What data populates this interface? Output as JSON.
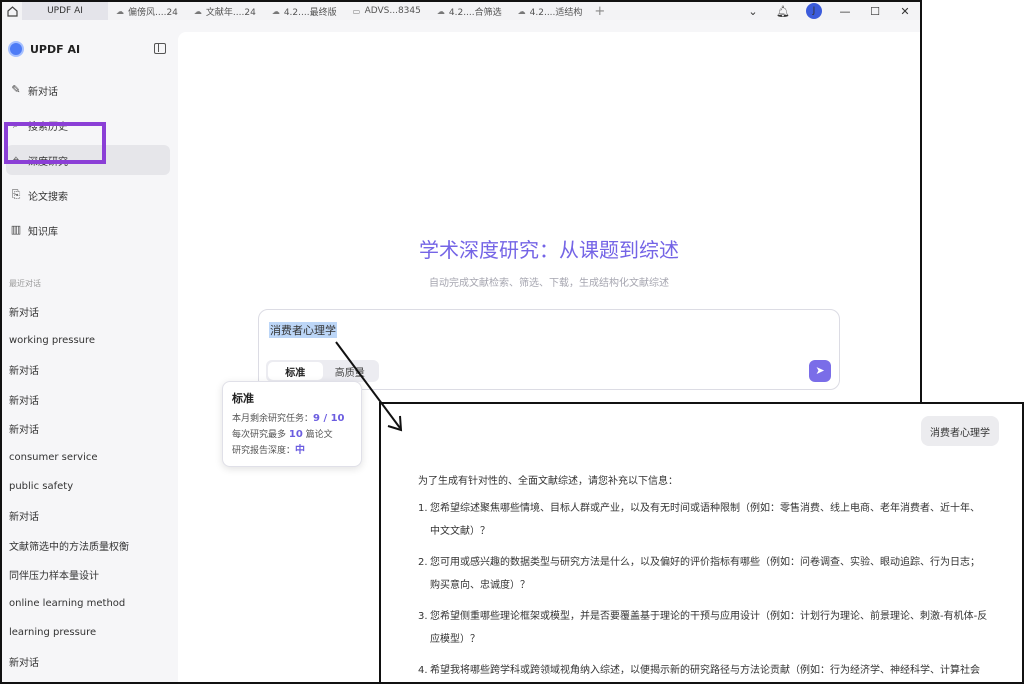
{
  "tabs": [
    {
      "label": "UPDF AI",
      "icon": "",
      "active": true
    },
    {
      "label": "偏傍风....24",
      "icon": "cloud-icon"
    },
    {
      "label": "文献年....24",
      "icon": "cloud-icon"
    },
    {
      "label": "4.2....最终版",
      "icon": "cloud-icon"
    },
    {
      "label": "ADVS...8345",
      "icon": "monitor-icon"
    },
    {
      "label": "4.2....合筛选",
      "icon": "cloud-icon"
    },
    {
      "label": "4.2....适结构",
      "icon": "cloud-icon"
    }
  ],
  "user_initial": "J",
  "brand": "UPDF AI",
  "nav": [
    {
      "label": "新对话",
      "icon": "edit-icon"
    },
    {
      "label": "搜索历史",
      "icon": "search-icon"
    },
    {
      "label": "深度研究",
      "icon": "telescope-icon"
    },
    {
      "label": "论文搜索",
      "icon": "paper-search-icon"
    },
    {
      "label": "知识库",
      "icon": "books-icon"
    }
  ],
  "recent_title": "最近对话",
  "recent": [
    "新对话",
    "working pressure",
    "新对话",
    "新对话",
    "新对话",
    "consumer service",
    "public safety",
    "新对话",
    "文献筛选中的方法质量权衡",
    "同伴压力样本量设计",
    "online learning method",
    "learning pressure",
    "新对话"
  ],
  "main": {
    "title": "学术深度研究：从课题到综述",
    "subtitle": "自动完成文献检索、筛选、下载，生成结构化文献综述",
    "input_text": "消费者心理学",
    "modes": [
      "标准",
      "高质量"
    ]
  },
  "tooltip": {
    "title": "标准",
    "row1_label": "本月剩余研究任务：",
    "row1_value": "9 / 10",
    "row2_prefix": "每次研究最多 ",
    "row2_value": "10",
    "row2_suffix": " 篇论文",
    "row3_label": "研究报告深度：",
    "row3_value": "中"
  },
  "zoom": {
    "user_message": "消费者心理学",
    "intro": "为了生成有针对性的、全面文献综述，请您补充以下信息：",
    "questions": [
      {
        "n": "1.",
        "text": "您希望综述聚焦哪些情境、目标人群或产业，以及有无时间或语种限制（例如：零售消费、线上电商、老年消费者、近十年、中文文献）？"
      },
      {
        "n": "2.",
        "text": "您可用或感兴趣的数据类型与研究方法是什么，以及偏好的评价指标有哪些（例如：问卷调查、实验、眼动追踪、行为日志；购买意向、忠诚度）？"
      },
      {
        "n": "3.",
        "text": "您希望侧重哪些理论框架或模型，并是否要覆盖基于理论的干预与应用设计（例如：计划行为理论、前景理论、刺激-有机体-反应模型）？"
      },
      {
        "n": "4.",
        "text": "希望我将哪些跨学科或跨领域视角纳入综述，以便揭示新的研究路径与方法论贡献（例如：行为经济学、神经科学、计算社会科学、市场学）？"
      }
    ]
  },
  "colors": {
    "accent": "#7464e6",
    "highlight_box": "#8b3fd6",
    "selection": "#bcd6f7"
  }
}
